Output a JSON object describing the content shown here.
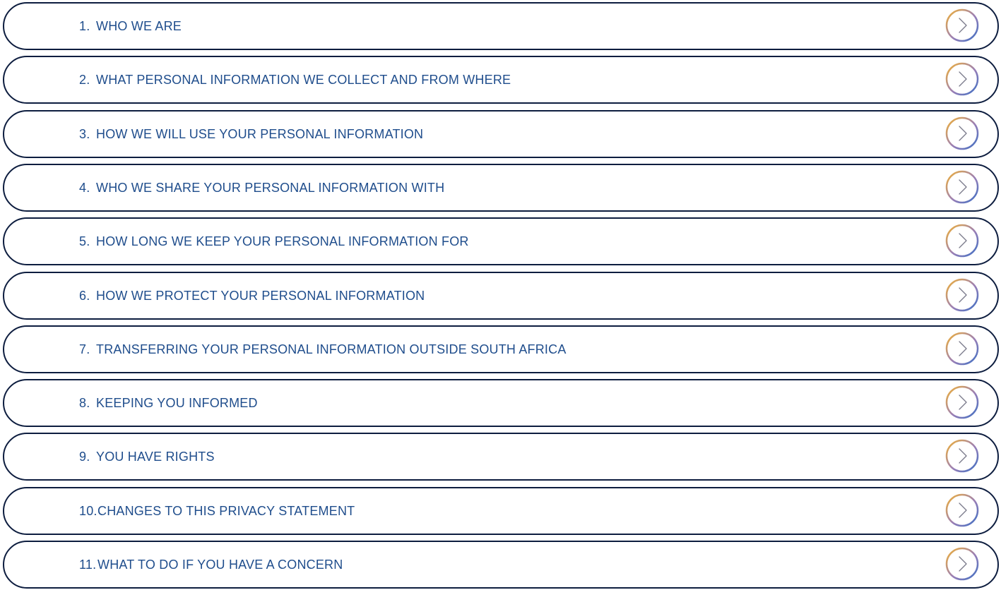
{
  "colors": {
    "row_border": "#0d1d3f",
    "text": "#1f4d8c",
    "ring_gold": "#f2b234",
    "ring_purple": "#9b7fb6",
    "ring_blue": "#3a6fc4",
    "chevron": "#7a7a8a"
  },
  "icons": {
    "arrow": "chevron-right-icon"
  },
  "sections": [
    {
      "number": "1.",
      "label": "WHO WE ARE"
    },
    {
      "number": "2.",
      "label": "WHAT PERSONAL INFORMATION WE COLLECT AND FROM WHERE"
    },
    {
      "number": "3.",
      "label": "HOW WE WILL USE YOUR PERSONAL INFORMATION"
    },
    {
      "number": "4.",
      "label": "WHO WE SHARE YOUR PERSONAL INFORMATION WITH"
    },
    {
      "number": "5.",
      "label": "HOW LONG WE KEEP YOUR PERSONAL INFORMATION FOR"
    },
    {
      "number": "6.",
      "label": "HOW WE PROTECT YOUR PERSONAL INFORMATION"
    },
    {
      "number": "7.",
      "label": "TRANSFERRING YOUR PERSONAL INFORMATION OUTSIDE SOUTH AFRICA"
    },
    {
      "number": "8.",
      "label": "KEEPING YOU INFORMED"
    },
    {
      "number": "9.",
      "label": "YOU HAVE RIGHTS"
    },
    {
      "number": "10.",
      "label": "CHANGES TO THIS PRIVACY STATEMENT"
    },
    {
      "number": "11.",
      "label": "WHAT TO DO IF YOU HAVE A CONCERN"
    }
  ]
}
